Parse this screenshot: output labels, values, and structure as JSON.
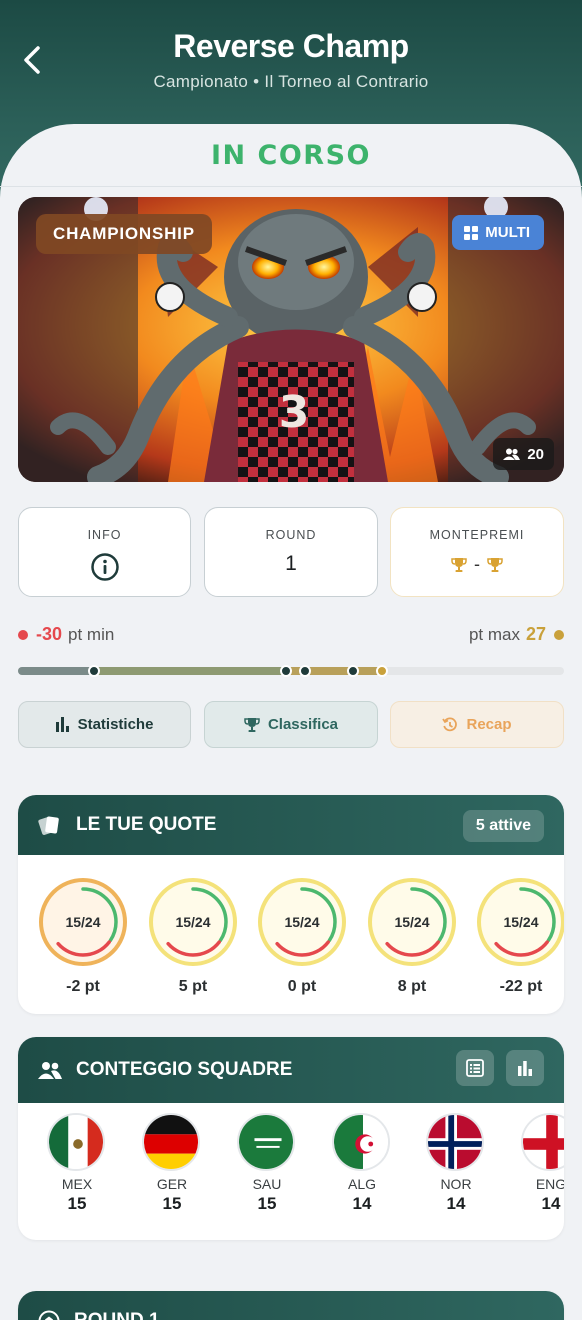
{
  "header": {
    "title": "Reverse Champ",
    "subtitle": "Campionato • Il Torneo al Contrario"
  },
  "status_label": "IN CORSO",
  "hero": {
    "badge": "CHAMPIONSHIP",
    "mode_badge": "MULTI",
    "participants": "20",
    "jersey_number": "3"
  },
  "info_cards": [
    {
      "label": "INFO",
      "icon": "info-icon"
    },
    {
      "label": "ROUND",
      "value": "1"
    },
    {
      "label": "MONTEPREMI",
      "value": "-",
      "icon": "trophy-icon"
    }
  ],
  "range": {
    "min_value": "-30",
    "min_label": "pt min",
    "max_label": "pt max",
    "max_value": "27"
  },
  "buttons": {
    "stats": "Statistiche",
    "ranking": "Classifica",
    "recap": "Recap"
  },
  "quotes_section": {
    "title": "LE TUE QUOTE",
    "active": "5 attive",
    "items": [
      {
        "ratio": "15/24",
        "points": "-2 pt",
        "progress": 0.625
      },
      {
        "ratio": "15/24",
        "points": "5 pt",
        "progress": 0.625
      },
      {
        "ratio": "15/24",
        "points": "0 pt",
        "progress": 0.625
      },
      {
        "ratio": "15/24",
        "points": "8 pt",
        "progress": 0.625
      },
      {
        "ratio": "15/24",
        "points": "-22 pt",
        "progress": 0.625
      }
    ]
  },
  "teams_section": {
    "title": "CONTEGGIO SQUADRE",
    "teams": [
      {
        "code": "MEX",
        "count": "15"
      },
      {
        "code": "GER",
        "count": "15"
      },
      {
        "code": "SAU",
        "count": "15"
      },
      {
        "code": "ALG",
        "count": "14"
      },
      {
        "code": "NOR",
        "count": "14"
      },
      {
        "code": "ENG",
        "count": "14"
      }
    ]
  },
  "round_section": {
    "title": "ROUND 1"
  },
  "colors": {
    "accent_green": "#3db36c",
    "header_teal": "#1e4c46",
    "gold": "#c9a13b",
    "negative": "#e5484d"
  }
}
